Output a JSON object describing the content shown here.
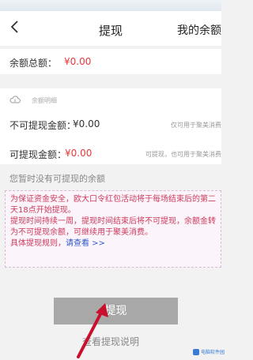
{
  "header": {
    "back_glyph": "<",
    "title": "提现",
    "right_title": "我的余额"
  },
  "balance_total": {
    "label": "余额总额：",
    "value": "¥0.00"
  },
  "balance_detail": {
    "title": "余额明细",
    "icon": "cloud-icon",
    "non_withdrawable": {
      "label": "不可提现金额：",
      "value": "¥0.00",
      "note": "仅可用于聚美消费"
    },
    "withdrawable": {
      "label": "可提现金额：",
      "value": "¥0.00",
      "note": "可提现，也可用于聚美消费"
    }
  },
  "no_balance_text": "您暂时没有可提现的余额",
  "notice": {
    "line1": "为保证资金安全，欧大口令红包活动将于每场结束后的第二天18点开始提现。",
    "line2": "提现时间持续一周，提现时间结束后将不可提现，余额金转为不可提现余额，可继续用于聚美消费。",
    "rules_prefix": "具体提现规则，",
    "rules_link": "请查看 >>"
  },
  "withdraw_button_label": "提现",
  "explain_link": "查看提现说明",
  "watermark_text": "电脑软件园",
  "colors": {
    "price_red": "#e4393c",
    "notice_text": "#cc3b5c",
    "link_blue": "#2f58c9",
    "button_disabled": "#a8a8a8",
    "annotation_arrow": "#c8102e"
  }
}
